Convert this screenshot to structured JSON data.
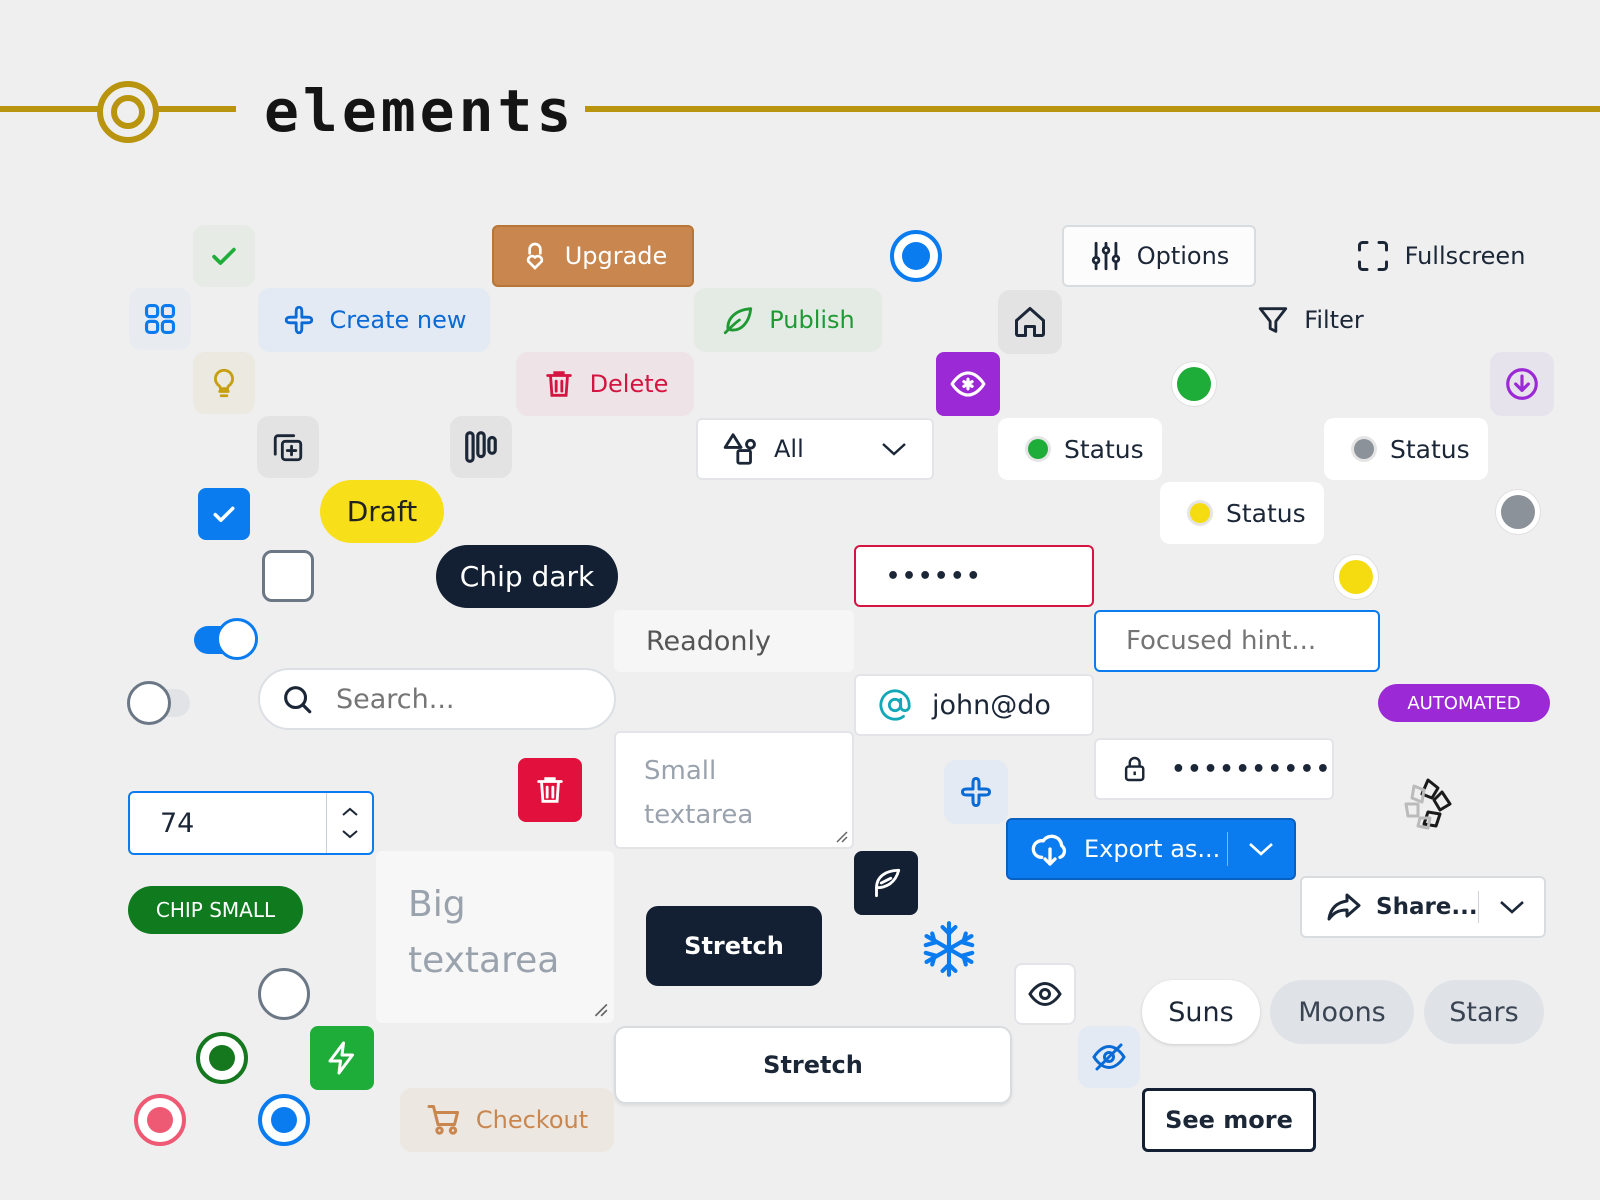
{
  "header": {
    "title": "elements",
    "accent": "#b8940f"
  },
  "buttons": {
    "upgrade": "Upgrade",
    "options": "Options",
    "fullscreen": "Fullscreen",
    "create_new": "Create new",
    "publish": "Publish",
    "filter": "Filter",
    "delete": "Delete",
    "stretch_dark": "Stretch",
    "stretch_light": "Stretch",
    "export": "Export as...",
    "share": "Share...",
    "see_more": "See more",
    "checkout": "Checkout"
  },
  "select": {
    "value": "All"
  },
  "status": [
    {
      "label": "Status",
      "color": "#1fad3a"
    },
    {
      "label": "Status",
      "color": "#8c9299"
    },
    {
      "label": "Status",
      "color": "#f4dc10"
    }
  ],
  "chips": {
    "draft": "Draft",
    "dark": "Chip dark",
    "small": "CHIP SMALL",
    "automated": "AUTOMATED"
  },
  "inputs": {
    "password_error": "••••••",
    "readonly": "Readonly",
    "focused_placeholder": "Focused hint...",
    "search_placeholder": "Search...",
    "email": "john@do",
    "password": "••••••••••",
    "number": "74",
    "small_textarea": "Small\ntextarea",
    "big_textarea": "Big\ntextarea"
  },
  "segmented": [
    "Suns",
    "Moons",
    "Stars"
  ],
  "icons": [
    "check-icon",
    "grid-icon",
    "bulb-icon",
    "copy-plus-icon",
    "bars-icon",
    "lock-heart-icon",
    "plus-icon",
    "leaf-icon",
    "trash-icon",
    "sliders-icon",
    "home-icon",
    "eye-icon",
    "fullscreen-icon",
    "filter-icon",
    "download-icon",
    "shapes-icon",
    "chevron-down-icon",
    "search-icon",
    "at-icon",
    "lock-icon",
    "cloud-download-icon",
    "share-icon",
    "feather-icon",
    "snowflake-icon",
    "eye-off-icon",
    "bolt-icon",
    "cart-icon",
    "logo-icon"
  ],
  "colors": {
    "blue": "#0a7cf0",
    "red": "#e1103c",
    "green": "#1f8a2e",
    "purple": "#9b29d6",
    "navy": "#132033",
    "yellow": "#f7e01a",
    "copper": "#c9874f"
  }
}
